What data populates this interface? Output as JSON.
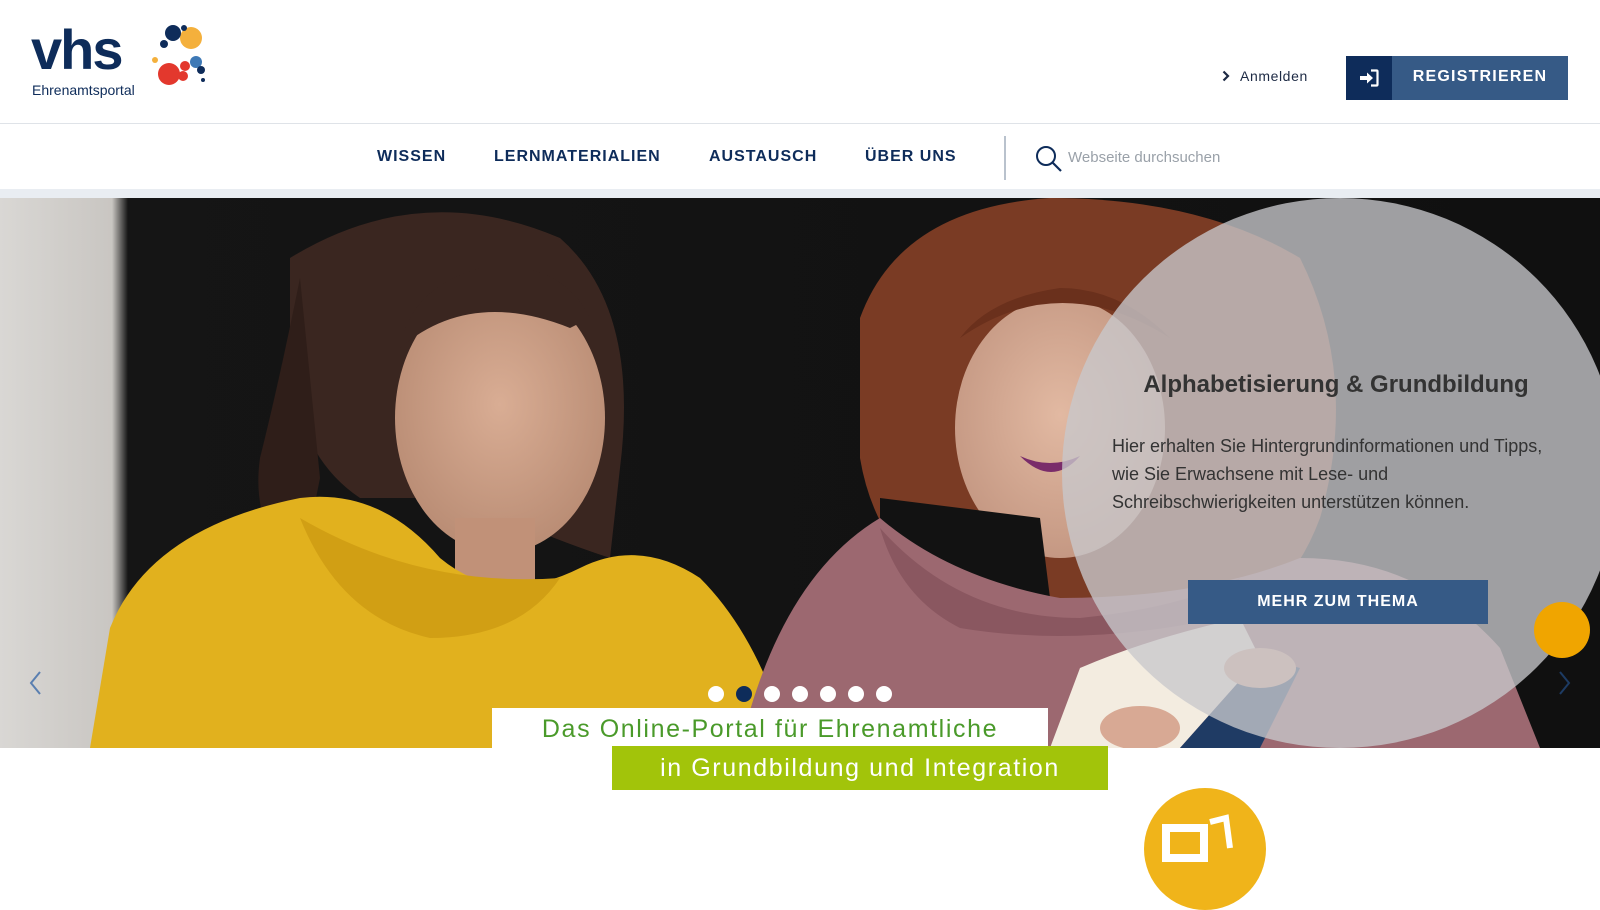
{
  "brand": {
    "logo_text": "vhs",
    "logo_subtitle": "Ehrenamtsportal"
  },
  "header": {
    "login_label": "Anmelden",
    "register_label": "REGISTRIEREN"
  },
  "nav": {
    "items": [
      {
        "label": "WISSEN"
      },
      {
        "label": "LERNMATERIALIEN"
      },
      {
        "label": "AUSTAUSCH"
      },
      {
        "label": "ÜBER UNS"
      }
    ],
    "search_placeholder": "Webseite durchsuchen"
  },
  "hero": {
    "title": "Alphabetisierung & Grundbildung",
    "text": "Hier erhalten Sie Hintergrundinformationen und Tipps, wie Sie Erwachsene mit Lese- und Schreibschwierigkeiten unterstützen können.",
    "button_label": "MEHR ZUM THEMA",
    "slide_count": 7,
    "active_slide": 2
  },
  "tagline": {
    "line1": "Das Online-Portal für Ehrenamtliche",
    "line2": "in Grundbildung und Integration"
  },
  "colors": {
    "navy": "#0e2c5a",
    "button_blue": "#365a86",
    "tag_green_text": "#4a9a2a",
    "tag_green_bg": "#a2c40a",
    "accent_orange": "#f0a500"
  },
  "icons": {
    "login": "chevron-right-icon",
    "register": "sign-in-icon",
    "search": "search-icon",
    "prev": "chevron-left-icon",
    "next": "chevron-right-icon"
  }
}
